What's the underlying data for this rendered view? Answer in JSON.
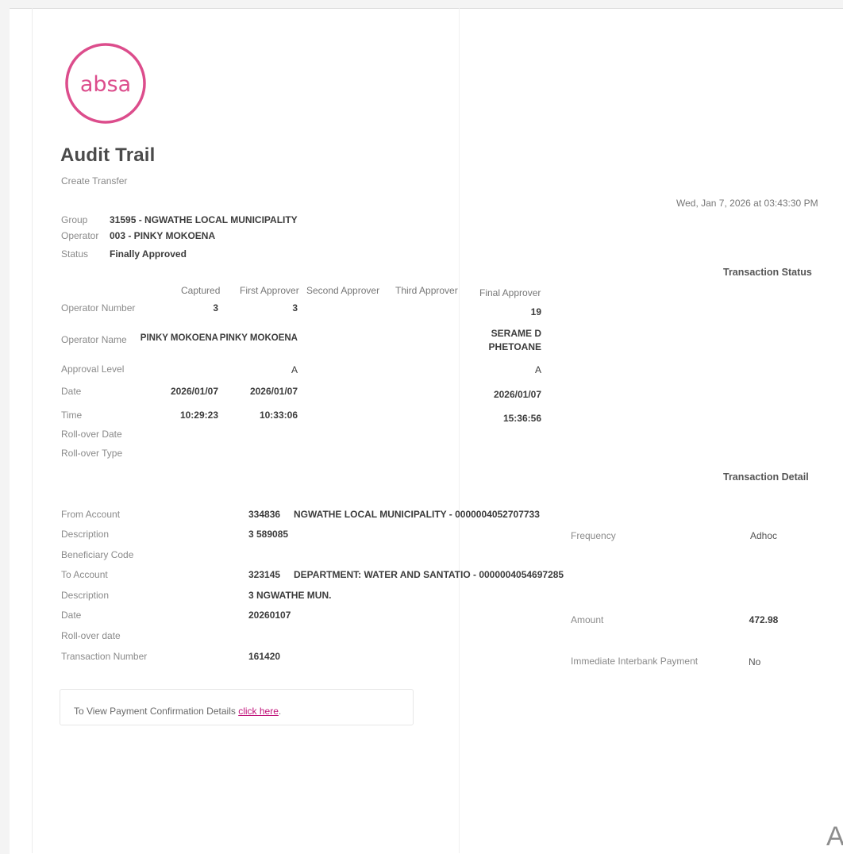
{
  "brand": {
    "logo_text": "absa",
    "logo_color": "#dc4d8c"
  },
  "header": {
    "title": "Audit Trail",
    "subtitle": "Create Transfer",
    "timestamp": "Wed, Jan 7, 2026 at 03:43:30 PM"
  },
  "meta": {
    "group_label": "Group",
    "group_value": "31595 - NGWATHE LOCAL MUNICIPALITY",
    "operator_label": "Operator",
    "operator_value": "003 - PINKY MOKOENA",
    "status_label": "Status",
    "status_value": "Finally Approved"
  },
  "transaction_status": {
    "heading": "Transaction Status",
    "columns": [
      "Captured",
      "First Approver",
      "Second Approver",
      "Third Approver",
      "Final Approver"
    ],
    "rows": [
      {
        "label": "Operator Number",
        "captured": "3",
        "first": "3",
        "final": "19"
      },
      {
        "label": "Operator Name",
        "captured": "PINKY MOKOENA",
        "first": "PINKY MOKOENA",
        "final_line1": "SERAME D",
        "final_line2": "PHETOANE"
      },
      {
        "label": "Approval Level",
        "first": "A",
        "final": "A"
      },
      {
        "label": "Date",
        "captured": "2026/01/07",
        "first": "2026/01/07",
        "final": "2026/01/07"
      },
      {
        "label": "Time",
        "captured": "10:29:23",
        "first": "10:33:06",
        "final": "15:36:56"
      },
      {
        "label": "Roll-over Date"
      },
      {
        "label": "Roll-over Type"
      }
    ]
  },
  "transaction_detail": {
    "heading": "Transaction Detail",
    "left": [
      {
        "label": "From Account",
        "value": "334836",
        "name": "NGWATHE LOCAL MUNICIPALITY - 0000004052707733"
      },
      {
        "label": "Description",
        "value": "3 589085"
      },
      {
        "label": "Beneficiary Code"
      },
      {
        "label": "To Account",
        "value": "323145",
        "name": "DEPARTMENT: WATER AND SANTATIO - 0000004054697285"
      },
      {
        "label": "Description",
        "value": "3 NGWATHE MUN."
      },
      {
        "label": "Date",
        "value": "20260107"
      },
      {
        "label": "Roll-over date"
      },
      {
        "label": "Transaction Number",
        "value": "161420"
      }
    ],
    "right": [
      {
        "label": "Frequency",
        "value": "Adhoc"
      },
      {
        "label": "Amount",
        "value": "472.98"
      },
      {
        "label": "Immediate Interbank Payment",
        "value": "No"
      }
    ]
  },
  "confirmation": {
    "text": "To View Payment Confirmation Details ",
    "link_text": "click here",
    "suffix": "."
  },
  "corner_fragment": "A"
}
